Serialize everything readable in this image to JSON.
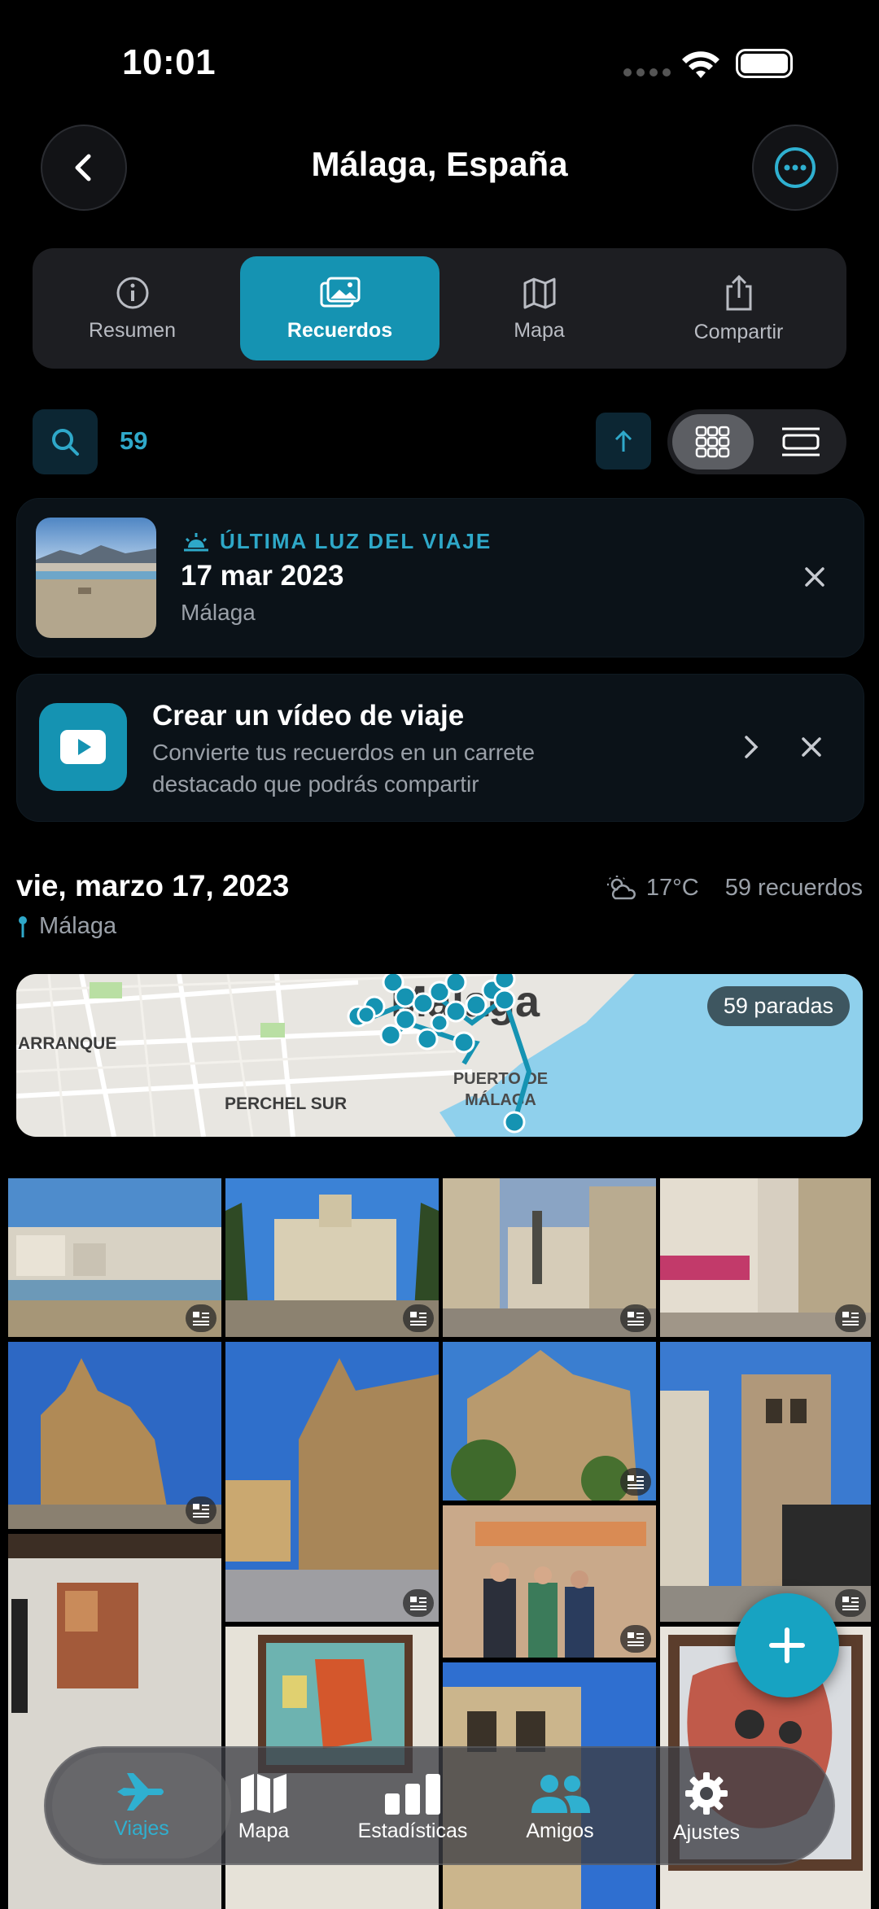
{
  "status": {
    "time": "10:01"
  },
  "header": {
    "title": "Málaga, España"
  },
  "tabs": [
    {
      "label": "Resumen",
      "icon": "info-icon"
    },
    {
      "label": "Recuerdos",
      "icon": "photos-icon"
    },
    {
      "label": "Mapa",
      "icon": "map-icon"
    },
    {
      "label": "Compartir",
      "icon": "share-icon"
    }
  ],
  "toolbar": {
    "count": "59"
  },
  "last_light": {
    "eyebrow": "ÚLTIMA LUZ DEL VIAJE",
    "date": "17 mar 2023",
    "place": "Málaga"
  },
  "video_card": {
    "title": "Crear un vídeo de viaje",
    "subtitle": "Convierte tus recuerdos en un carrete destacado que podrás compartir"
  },
  "day": {
    "title": "vie, marzo 17, 2023",
    "place": "Málaga",
    "temperature": "17°C",
    "memories": "59 recuerdos",
    "map_labels": [
      "Málaga",
      "ARRANQUE",
      "PERCHEL SUR",
      "PUERTO DE MÁLAGA"
    ],
    "stops": "59 paradas"
  },
  "tabbar": [
    {
      "label": "Viajes",
      "icon": "airplane-icon"
    },
    {
      "label": "Mapa",
      "icon": "map-icon"
    },
    {
      "label": "Estadísticas",
      "icon": "bar-chart-icon"
    },
    {
      "label": "Amigos",
      "icon": "people-icon"
    },
    {
      "label": "Ajustes",
      "icon": "gear-icon"
    }
  ],
  "colors": {
    "accent": "#1593b2",
    "accent_text": "#2fa8c9",
    "background": "#000000"
  }
}
